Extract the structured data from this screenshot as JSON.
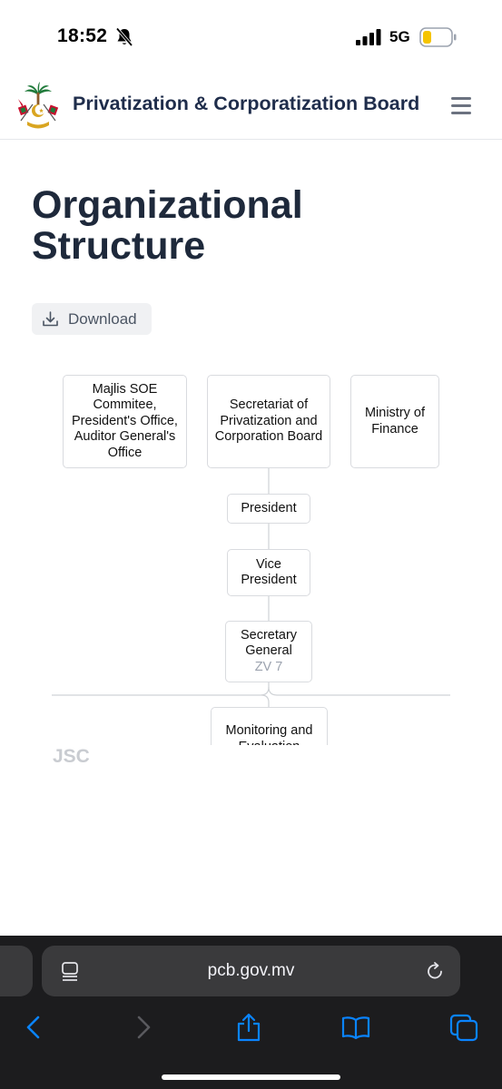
{
  "status_bar": {
    "time": "18:52",
    "network": "5G",
    "battery_color": "#f5c400"
  },
  "header": {
    "title": "Privatization & Corporatization Board",
    "menu_icon": "hamburger-icon"
  },
  "page": {
    "title": "Organizational Structure",
    "download_label": "Download"
  },
  "org_chart": {
    "top_row": [
      "Majlis SOE Commitee, President's Office, Auditor General's Office",
      "Secretariat of Privatization and Corporation Board",
      "Ministry of Finance"
    ],
    "president": "President",
    "vice_president": "Vice President",
    "secretary_general": {
      "title": "Secretary General",
      "grade": "ZV 7"
    },
    "monitoring": "Monitoring and Evaluation"
  },
  "watermark": "JSC",
  "browser": {
    "url": "pcb.gov.mv",
    "accent_color": "#0a84ff",
    "icons": [
      "back-icon",
      "forward-icon",
      "share-icon",
      "bookmarks-icon",
      "tabs-icon"
    ]
  }
}
